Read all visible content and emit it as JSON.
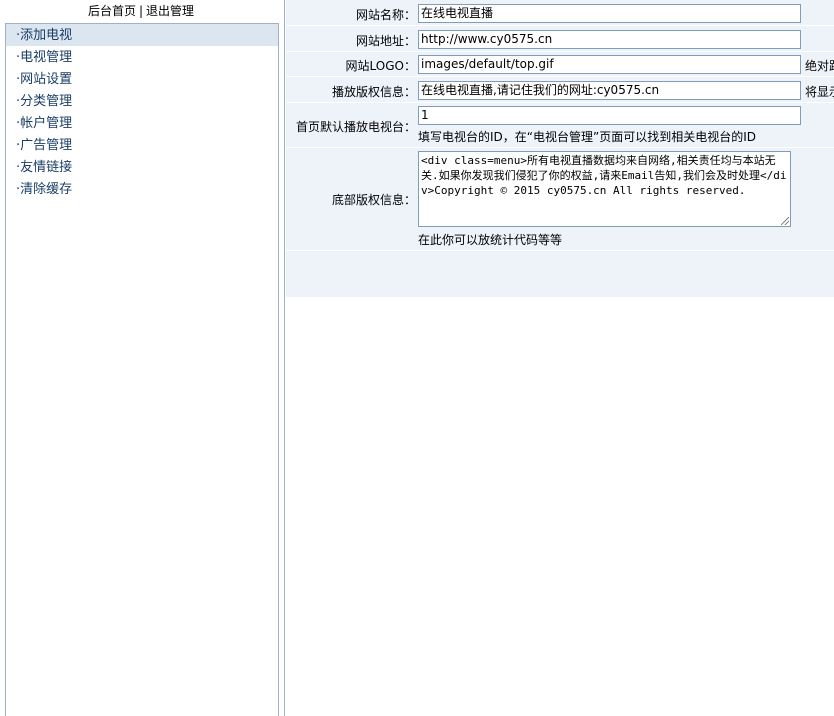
{
  "nav": {
    "home_link": "后台首页",
    "separator": "|",
    "logout_link": "退出管理"
  },
  "menu": {
    "items": [
      {
        "label": "·添加电视"
      },
      {
        "label": "·电视管理"
      },
      {
        "label": "·网站设置"
      },
      {
        "label": "·分类管理"
      },
      {
        "label": "·帐户管理"
      },
      {
        "label": "·广告管理"
      },
      {
        "label": "·友情链接"
      },
      {
        "label": "·清除缓存"
      }
    ]
  },
  "form": {
    "site_name": {
      "label": "网站名称：",
      "value": "在线电视直播"
    },
    "site_url": {
      "label": "网站地址：",
      "value": "http://www.cy0575.cn"
    },
    "site_logo": {
      "label": "网站LOGO：",
      "value": "images/default/top.gif",
      "note": "绝对路"
    },
    "play_copyright": {
      "label": "播放版权信息：",
      "value": "在线电视直播,请记住我们的网址:cy0575.cn",
      "note": "将显示"
    },
    "default_channel": {
      "label": "首页默认播放电视台：",
      "value": "1",
      "note": "填写电视台的ID，在“电视台管理”页面可以找到相关电视台的ID"
    },
    "footer_copyright": {
      "label": "底部版权信息：",
      "value": "<div class=menu>所有电视直播数据均来自网络,相关责任均与本站无关.如果你发现我们侵犯了你的权益,请来Email告知,我们会及时处理</div>Copyright © 2015 cy0575.cn All rights reserved.",
      "note": "在此你可以放统计代码等等"
    }
  },
  "colors": {
    "menu_text": "#1a3e66",
    "form_bg": "#eef3fa",
    "menu_highlight": "#dbe6f1",
    "border": "#9db3c5"
  }
}
